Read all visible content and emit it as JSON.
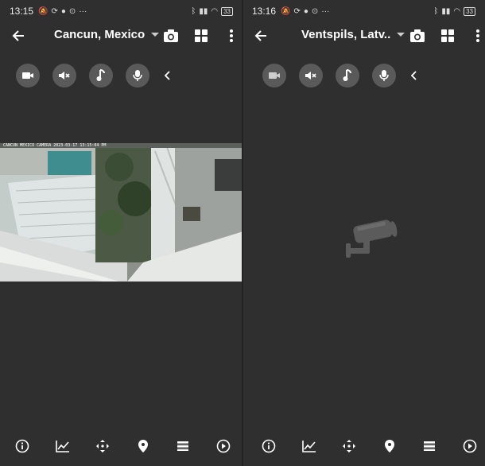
{
  "panes": [
    {
      "status_time": "13:15",
      "battery": "33",
      "title": "Cancun, Mexico",
      "stream_overlay": "CANCUN MEXICO CAMERA 2023-03-17 13:15:04 PM"
    },
    {
      "status_time": "13:16",
      "battery": "33",
      "title": "Ventspils, Latv.."
    }
  ],
  "icons": {
    "back": "arrow-left-icon",
    "dropdown": "caret-down-icon",
    "snapshot": "camera-icon",
    "grid": "grid-icon",
    "more": "more-vertical-icon",
    "video": "video-camera-icon",
    "mute": "volume-mute-icon",
    "music": "music-note-icon",
    "mic": "microphone-icon",
    "collapse": "chevron-left-icon",
    "info": "info-icon",
    "chart": "line-chart-icon",
    "move": "move-arrows-icon",
    "location": "map-pin-icon",
    "list": "list-icon",
    "play": "play-circle-icon"
  },
  "colors": {
    "background": "#2f2f2f",
    "control_bg": "#5a5a5a",
    "icon": "#ffffff"
  }
}
